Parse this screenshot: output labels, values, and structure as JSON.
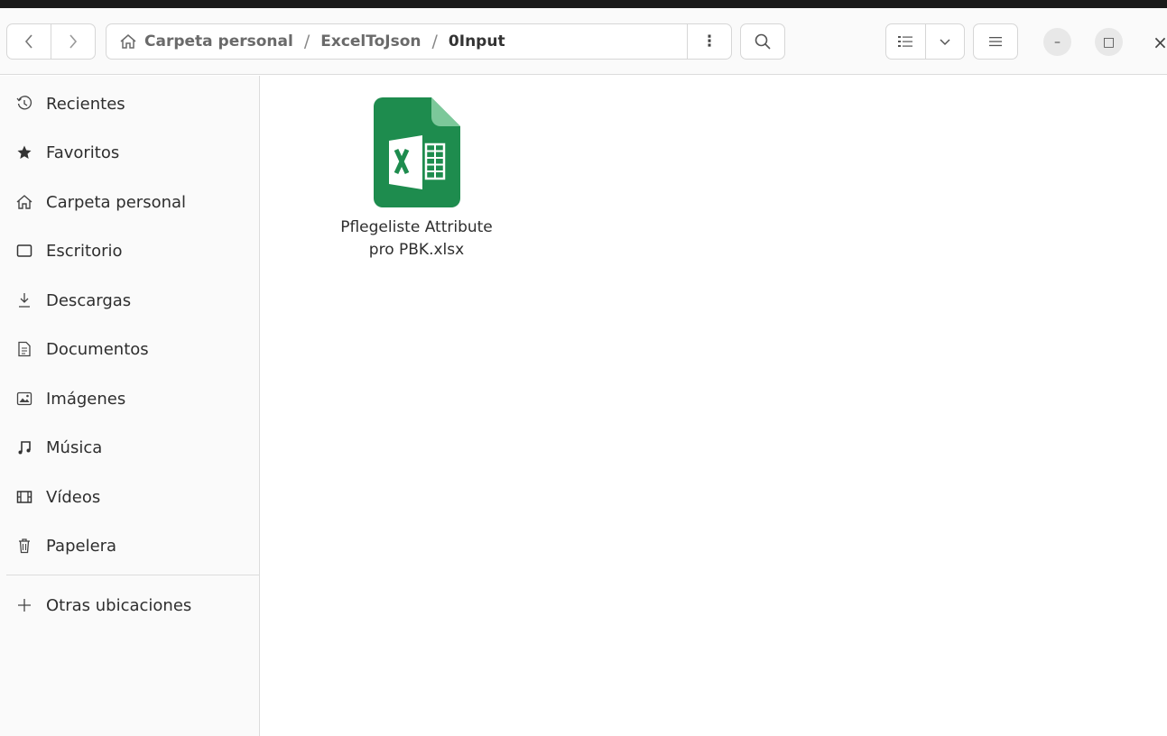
{
  "window": {
    "path": [
      {
        "label": "Carpeta personal"
      },
      {
        "label": "ExcelToJson"
      },
      {
        "label": "0Input"
      }
    ],
    "path_separator": "/",
    "path_menu_glyph": "⋮",
    "close_glyph": "×",
    "minimize_glyph": "–",
    "maximize_glyph": "□"
  },
  "sidebar": {
    "items": [
      {
        "label": "Recientes",
        "icon": "clock-icon"
      },
      {
        "label": "Favoritos",
        "icon": "star-icon"
      },
      {
        "label": "Carpeta personal",
        "icon": "home-icon"
      },
      {
        "label": "Escritorio",
        "icon": "desktop-icon"
      },
      {
        "label": "Descargas",
        "icon": "download-icon"
      },
      {
        "label": "Documentos",
        "icon": "document-icon"
      },
      {
        "label": "Imágenes",
        "icon": "image-icon"
      },
      {
        "label": "Música",
        "icon": "music-icon"
      },
      {
        "label": "Vídeos",
        "icon": "video-icon"
      },
      {
        "label": "Papelera",
        "icon": "trash-icon"
      }
    ],
    "other_locations": {
      "label": "Otras ubicaciones",
      "icon": "plus-icon"
    }
  },
  "files": [
    {
      "name_line1": "Pflegeliste Attribute",
      "name_line2": "pro PBK.xlsx",
      "icon": "excel-file-icon"
    }
  ],
  "colors": {
    "excel_green": "#1e8c4e",
    "excel_fold": "#7cc89a"
  }
}
